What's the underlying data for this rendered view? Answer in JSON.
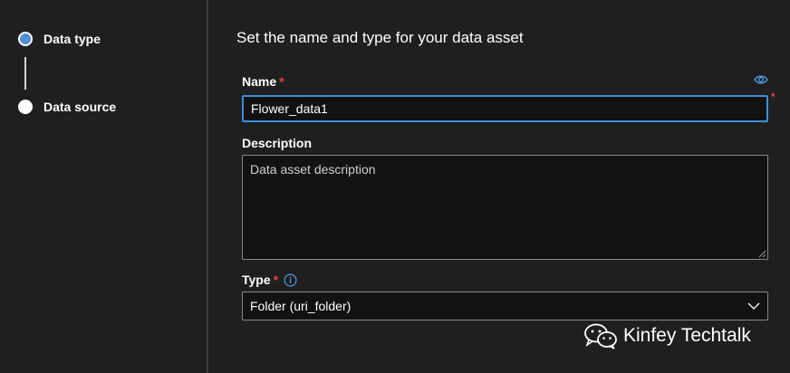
{
  "stepper": {
    "steps": [
      {
        "label": "Data type",
        "state": "active"
      },
      {
        "label": "Data source",
        "state": "inactive"
      }
    ]
  },
  "form": {
    "title": "Set the name and type for your data asset",
    "name": {
      "label": "Name",
      "required_mark": "*",
      "value": "Flower_data1"
    },
    "description": {
      "label": "Description",
      "placeholder": "Data asset description",
      "value": ""
    },
    "type": {
      "label": "Type",
      "required_mark": "*",
      "selected": "Folder (uri_folder)"
    },
    "side_required_mark": "*"
  },
  "watermark": {
    "text": "Kinfey Techtalk",
    "icon": "wechat-icon"
  },
  "colors": {
    "background": "#1f1f1f",
    "accent": "#3c8fd9",
    "required": "#e0443e",
    "input_bg": "#121212"
  },
  "icons": {
    "name_field": "eye-icon",
    "type_field": "info-icon",
    "dropdown": "chevron-down-icon"
  }
}
